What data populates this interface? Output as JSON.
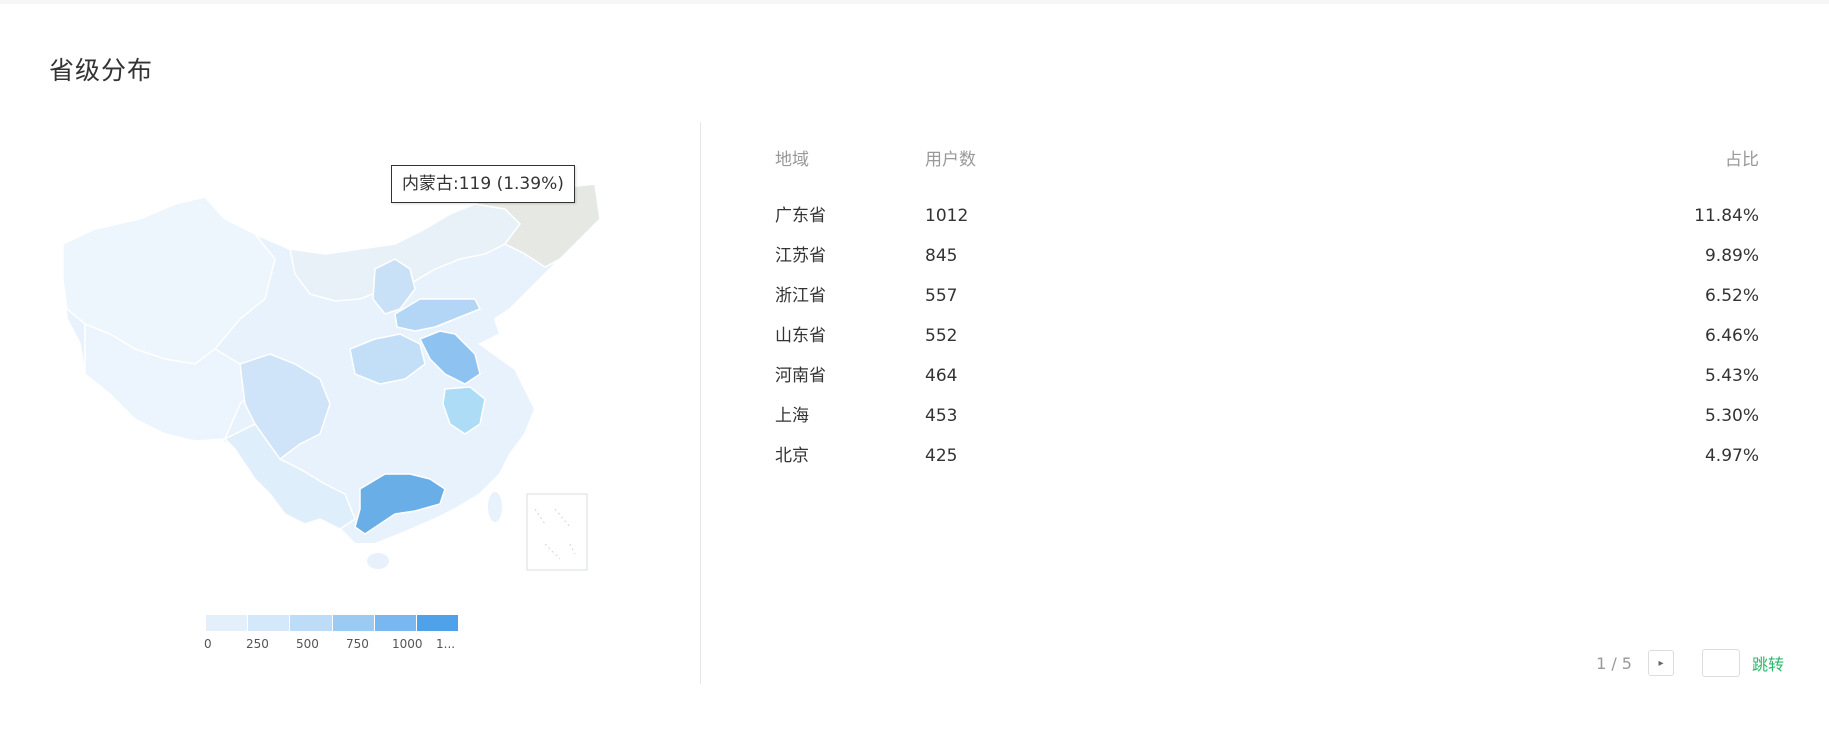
{
  "section_title": "省级分布",
  "tooltip": {
    "text": "内蒙古:119 (1.39%)"
  },
  "legend": {
    "ticks": [
      "0",
      "250",
      "500",
      "750",
      "1000",
      "1..."
    ],
    "colors": [
      "#e3f0fc",
      "#d3e8fa",
      "#bcdcf7",
      "#9bcbf3",
      "#78b7ef",
      "#4fa1ea"
    ]
  },
  "table": {
    "headers": {
      "region": "地域",
      "users": "用户数",
      "ratio": "占比"
    },
    "rows": [
      {
        "region": "广东省",
        "users": "1012",
        "ratio": "11.84%"
      },
      {
        "region": "江苏省",
        "users": "845",
        "ratio": "9.89%"
      },
      {
        "region": "浙江省",
        "users": "557",
        "ratio": "6.52%"
      },
      {
        "region": "山东省",
        "users": "552",
        "ratio": "6.46%"
      },
      {
        "region": "河南省",
        "users": "464",
        "ratio": "5.43%"
      },
      {
        "region": "上海",
        "users": "453",
        "ratio": "5.30%"
      },
      {
        "region": "北京",
        "users": "425",
        "ratio": "4.97%"
      }
    ]
  },
  "pagination": {
    "page_indicator": "1 / 5",
    "next_icon": "▸",
    "jump_label": "跳转"
  },
  "colors": {
    "accent_green": "#2db86b",
    "highlight_region": "#e6e8e3",
    "top_region": "#6aaee8"
  }
}
